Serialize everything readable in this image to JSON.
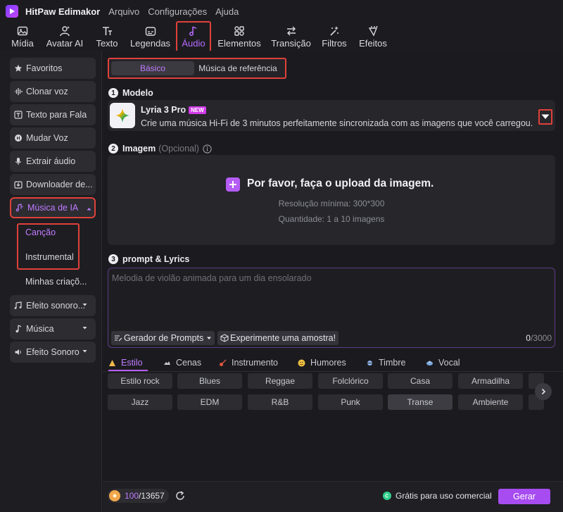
{
  "app": {
    "name": "HitPaw Edimakor",
    "menu": [
      "Arquivo",
      "Configurações",
      "Ajuda"
    ]
  },
  "toolbar": {
    "items": [
      {
        "label": "Mídia",
        "icon": "image-icon"
      },
      {
        "label": "Avatar AI",
        "icon": "avatar-icon"
      },
      {
        "label": "Texto",
        "icon": "text-icon"
      },
      {
        "label": "Legendas",
        "icon": "captions-icon"
      },
      {
        "label": "Áudio",
        "icon": "music-note-icon",
        "active": true
      },
      {
        "label": "Elementos",
        "icon": "elements-icon"
      },
      {
        "label": "Transição",
        "icon": "transition-icon"
      },
      {
        "label": "Filtros",
        "icon": "filters-icon"
      },
      {
        "label": "Efeitos",
        "icon": "effects-icon"
      }
    ]
  },
  "sidebar": {
    "items": [
      {
        "label": "Favoritos",
        "icon": "star-icon"
      },
      {
        "label": "Clonar voz",
        "icon": "voice-wave-icon"
      },
      {
        "label": "Texto para Fala",
        "icon": "text-to-speech-icon"
      },
      {
        "label": "Mudar Voz",
        "icon": "voice-change-icon"
      },
      {
        "label": "Extrair áudio",
        "icon": "microphone-icon"
      },
      {
        "label": "Downloader de...",
        "icon": "download-icon"
      },
      {
        "label": "Música de IA",
        "icon": "ai-music-icon",
        "active": true
      }
    ],
    "sub_items": [
      "Canção",
      "Instrumental",
      "Minhas criaçõ..."
    ],
    "more_items": [
      {
        "label": "Efeito sonoro...",
        "icon": "music-notes-icon"
      },
      {
        "label": "Música",
        "icon": "music-note-icon"
      },
      {
        "label": "Efeito Sonoro",
        "icon": "sound-effect-icon"
      }
    ]
  },
  "tabs": {
    "basic": "Básico",
    "reference": "Música de referência"
  },
  "model": {
    "section_num": "1",
    "section_label": "Modelo",
    "name": "Lyria 3 Pro",
    "badge": "NEW",
    "description": "Crie uma música Hi-Fi de 3 minutos perfeitamente sincronizada com as imagens que você carregou."
  },
  "image": {
    "section_num": "2",
    "section_label": "Imagem",
    "optional": "(Opcional)",
    "upload_title": "Por favor, faça o upload da imagem.",
    "min_resolution": "Resolução mínima: 300*300",
    "quantity": "Quantidade: 1 a 10 imagens"
  },
  "prompt": {
    "section_num": "3",
    "section_label": "prompt & Lyrics",
    "placeholder": "Melodia de violão animada para um dia ensolarado",
    "prompt_generator": "Gerador de Prompts",
    "try_sample": "Experimente uma amostra!",
    "count": "0",
    "max": "/3000"
  },
  "categories": [
    {
      "label": "Estilo",
      "icon": "style-icon",
      "active": true
    },
    {
      "label": "Cenas",
      "icon": "scenes-icon"
    },
    {
      "label": "Instrumento",
      "icon": "guitar-icon"
    },
    {
      "label": "Humores",
      "icon": "mood-icon"
    },
    {
      "label": "Timbre",
      "icon": "timbre-icon"
    },
    {
      "label": "Vocal",
      "icon": "vocal-icon"
    }
  ],
  "tags_row1": [
    "Estilo rock",
    "Blues",
    "Reggae",
    "Folclórico",
    "Casa",
    "Armadilha"
  ],
  "tags_row2": [
    "Jazz",
    "EDM",
    "R&B",
    "Punk",
    "Transe",
    "Ambiente"
  ],
  "selected_tag": "Transe",
  "footer": {
    "credits_current": "100",
    "credits_total": "/13657",
    "commercial": "Grátis para uso comercial",
    "generate": "Gerar"
  },
  "colors": {
    "accent": "#b65cf6",
    "highlight_box": "#e0413a",
    "background": "#1b1b1f"
  }
}
